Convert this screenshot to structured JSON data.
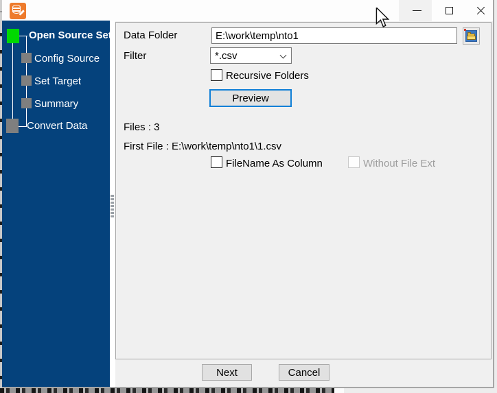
{
  "window": {
    "title": "",
    "app_icon": "database-edit-icon",
    "controls": {
      "minimize": "minimize",
      "maximize": "maximize",
      "close": "close"
    }
  },
  "sidebar": {
    "items": [
      {
        "label": "Open Source Set",
        "state": "active"
      },
      {
        "label": "Config Source",
        "state": "pending"
      },
      {
        "label": "Set Target",
        "state": "pending"
      },
      {
        "label": "Summary",
        "state": "pending"
      },
      {
        "label": "Convert Data",
        "state": "pending"
      }
    ]
  },
  "form": {
    "data_folder": {
      "label": "Data Folder",
      "value": "E:\\work\\temp\\nto1"
    },
    "filter": {
      "label": "Filter",
      "value": "*.csv"
    },
    "recursive_folders": {
      "label": "Recursive Folders",
      "checked": false
    },
    "preview_button": "Preview",
    "files_count": "Files : 3",
    "first_file": "First File : E:\\work\\temp\\nto1\\1.csv",
    "filename_as_column": {
      "label": "FileName As Column",
      "checked": false
    },
    "without_file_ext": {
      "label": "Without File Ext",
      "checked": false,
      "disabled": true
    }
  },
  "footer": {
    "next": "Next",
    "cancel": "Cancel"
  },
  "colors": {
    "sidebar_background": "#05427c",
    "active_step": "#00d800",
    "pending_step": "#7f7f7f",
    "accent_focus": "#0f7fd7",
    "icon_orange": "#ee7b2c"
  }
}
